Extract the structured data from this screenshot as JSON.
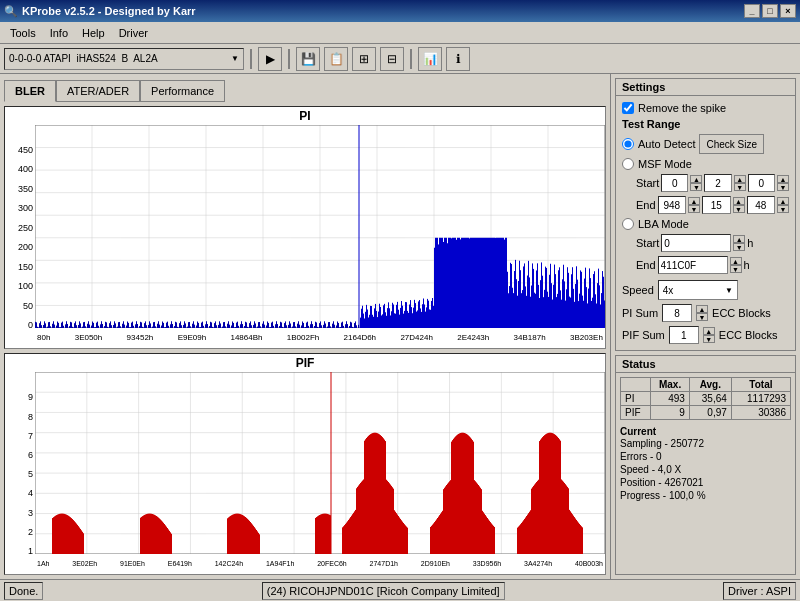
{
  "titlebar": {
    "title": "KProbe v2.5.2 - Designed by Karr",
    "buttons": [
      "_",
      "□",
      "×"
    ]
  },
  "menu": {
    "items": [
      "Tools",
      "Info",
      "Help",
      "Driver"
    ]
  },
  "toolbar": {
    "drive_info": "0-0-0-0  ATAPI",
    "drive_model": "iHAS524",
    "drive_channel": "B",
    "firmware": "AL2A",
    "buttons": [
      "play",
      "stop",
      "save",
      "copy",
      "settings1",
      "settings2",
      "graph",
      "info"
    ]
  },
  "tabs": {
    "items": [
      "BLER",
      "ATER/ADER",
      "Performance"
    ],
    "active": 0
  },
  "pi_chart": {
    "title": "PI",
    "y_labels": [
      "450",
      "400",
      "350",
      "300",
      "250",
      "200",
      "150",
      "100",
      "50",
      "0"
    ],
    "x_labels": [
      "80h",
      "3E050h",
      "93452h",
      "E9E09h",
      "14864Bh",
      "1B002Fh",
      "2164D6h",
      "27D424h",
      "2E4243h",
      "34B187h",
      "3B203Eh"
    ]
  },
  "pif_chart": {
    "title": "PIF",
    "y_labels": [
      "9",
      "8",
      "7",
      "6",
      "5",
      "4",
      "3",
      "2",
      "1"
    ],
    "x_labels": [
      "1Ah",
      "3E02Eh",
      "91E0Eh",
      "E6419h",
      "142C24h",
      "1A94F1h",
      "20FEC6h",
      "2747D1h",
      "2D910Eh",
      "33D956h",
      "3A4274h",
      "40B003h"
    ]
  },
  "settings": {
    "header": "Settings",
    "remove_spike_label": "Remove the spike",
    "remove_spike_checked": true,
    "test_range_label": "Test Range",
    "auto_detect_label": "Auto Detect",
    "msf_mode_label": "MSF Mode",
    "lba_mode_label": "LBA Mode",
    "check_size_btn": "Check Size",
    "start_label": "Start",
    "end_label": "End",
    "msf_start": [
      "0",
      "2",
      "0"
    ],
    "msf_end": [
      "948",
      "15",
      "48"
    ],
    "lba_start": "0",
    "lba_end": "411C0F",
    "lba_h": "h",
    "speed_label": "Speed",
    "speed_value": "4x",
    "pi_sum_label": "PI Sum",
    "pi_sum_value": "8",
    "ecc_blocks_label1": "ECC Blocks",
    "pif_sum_label": "PIF Sum",
    "pif_sum_value": "1",
    "ecc_blocks_label2": "ECC Blocks"
  },
  "status": {
    "header": "Status",
    "col_headers": [
      "",
      "Max.",
      "Avg.",
      "Total"
    ],
    "rows": [
      {
        "label": "PI",
        "max": "493",
        "avg": "35,64",
        "total": "1117293"
      },
      {
        "label": "PIF",
        "max": "9",
        "avg": "0,97",
        "total": "30386"
      }
    ],
    "current_label": "Current",
    "sampling": "250772",
    "errors": "0",
    "speed": "4,0  X",
    "position": "4267021",
    "progress": "100,0  %"
  },
  "statusbar": {
    "left": "Done.",
    "center": "(24) RICOHJPND01C [Ricoh Company Limited]",
    "right": "Driver : ASPI"
  }
}
